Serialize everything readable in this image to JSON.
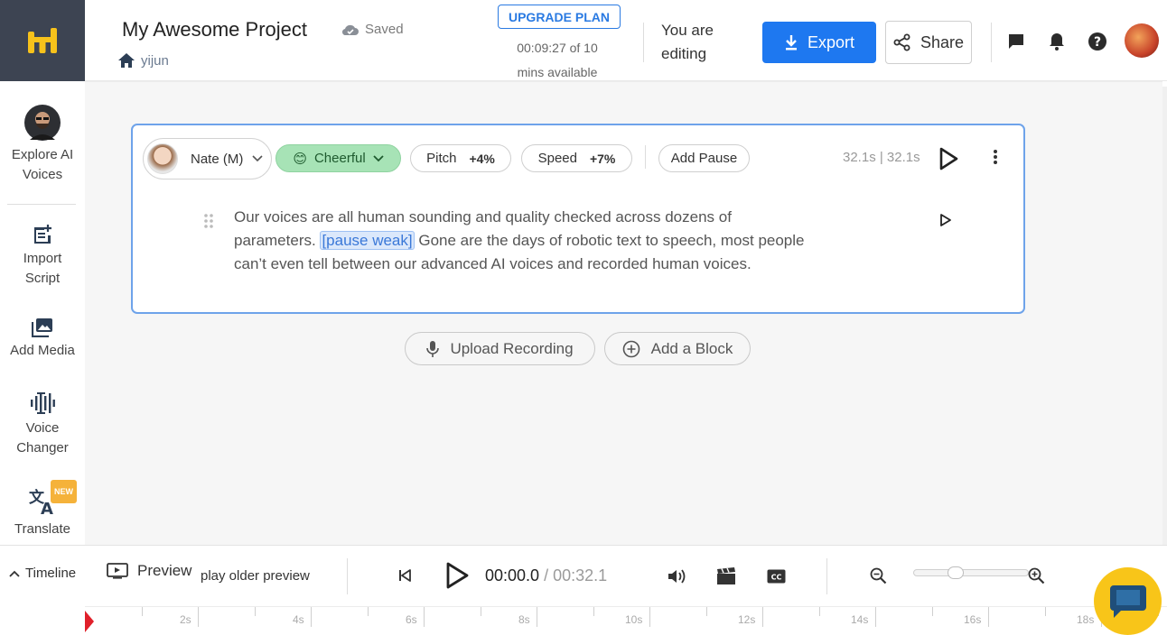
{
  "header": {
    "project_title": "My Awesome Project",
    "saved_status": "Saved",
    "breadcrumb_user": "yijun",
    "upgrade_label": "UPGRADE PLAN",
    "minutes_line1": "00:09:27 of 10",
    "minutes_line2": "mins available",
    "editing_line1": "You are",
    "editing_line2": "editing",
    "export_label": "Export",
    "share_label": "Share",
    "accent_color": "#1e78f0"
  },
  "sidebar": {
    "items": [
      {
        "label_line1": "Explore AI",
        "label_line2": "Voices",
        "icon": "voice-avatar-icon"
      },
      {
        "label_line1": "Import",
        "label_line2": "Script",
        "icon": "import-script-icon"
      },
      {
        "label_line1": "Add Media",
        "label_line2": "",
        "icon": "media-icon"
      },
      {
        "label_line1": "Voice",
        "label_line2": "Changer",
        "icon": "voice-changer-icon"
      },
      {
        "label_line1": "Translate",
        "label_line2": "",
        "icon": "translate-icon",
        "badge": "NEW"
      }
    ]
  },
  "block": {
    "voice_name": "Nate (M)",
    "emotion": "Cheerful",
    "emotion_emoji": "😊",
    "pitch_label": "Pitch",
    "pitch_value": "+4%",
    "speed_label": "Speed",
    "speed_value": "+7%",
    "add_pause_label": "Add Pause",
    "duration": "32.1s | 32.1s",
    "text_before": "Our voices are all human sounding and quality checked across dozens of parameters. ",
    "pause_tag": "[pause weak]",
    "text_after": " Gone are the days of robotic text to speech, most people  can’t even tell between our advanced AI voices and recorded human voices."
  },
  "actions": {
    "upload_label": "Upload Recording",
    "add_block_label": "Add a Block"
  },
  "transport": {
    "timeline_label": "Timeline",
    "preview_label": "Preview",
    "older_preview_label": "play older preview",
    "current_time": "00:00.0",
    "separator": " / ",
    "total_time": "00:32.1",
    "zoom_level": 0.34
  },
  "ruler": {
    "labels": [
      "2s",
      "4s",
      "6s",
      "8s",
      "10s",
      "12s",
      "14s",
      "16s",
      "18s"
    ]
  }
}
